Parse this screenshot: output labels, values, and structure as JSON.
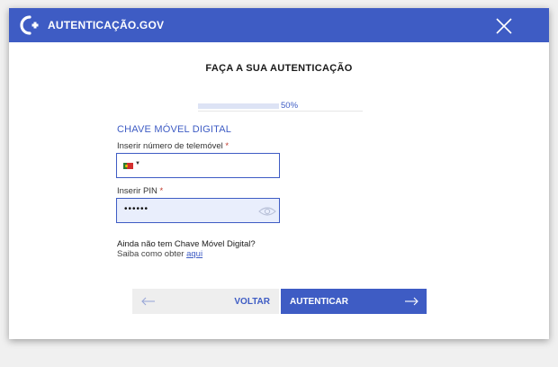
{
  "header": {
    "title": "AUTENTICAÇÃO.GOV",
    "logo_icon": "autenticacao-logo-icon",
    "close_icon": "close-icon"
  },
  "page": {
    "title": "FAÇA A SUA AUTENTICAÇÃO"
  },
  "progress": {
    "percent": 50,
    "label": "50%"
  },
  "form": {
    "section_title": "CHAVE MÓVEL DIGITAL",
    "phone": {
      "label": "Inserir número de telemóvel",
      "required_mark": "*",
      "country_flag": "portugal-flag-icon",
      "value": ""
    },
    "pin": {
      "label": "Inserir PIN",
      "required_mark": "*",
      "value": "••••••"
    }
  },
  "help": {
    "question": "Ainda não tem Chave Móvel Digital?",
    "prefix": "Saiba como obter",
    "link": "aqui"
  },
  "actions": {
    "back_label": "VOLTAR",
    "authenticate_label": "AUTENTICAR"
  },
  "colors": {
    "brand": "#3e5cc4",
    "pin_background": "#e9eefc"
  }
}
